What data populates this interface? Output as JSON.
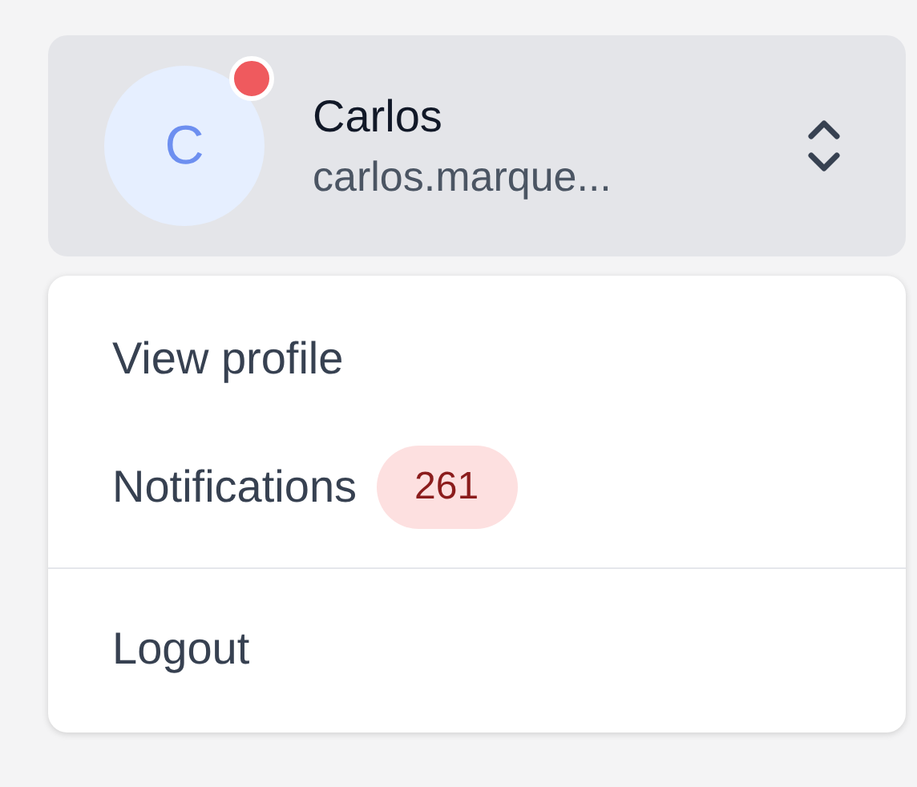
{
  "account": {
    "initial": "C",
    "name": "Carlos",
    "email": "carlos.marque...",
    "notification_dot": true
  },
  "menu": {
    "groups": [
      [
        {
          "label": "View profile"
        },
        {
          "label": "Notifications",
          "badge": "261"
        }
      ],
      [
        {
          "label": "Logout"
        }
      ]
    ]
  }
}
